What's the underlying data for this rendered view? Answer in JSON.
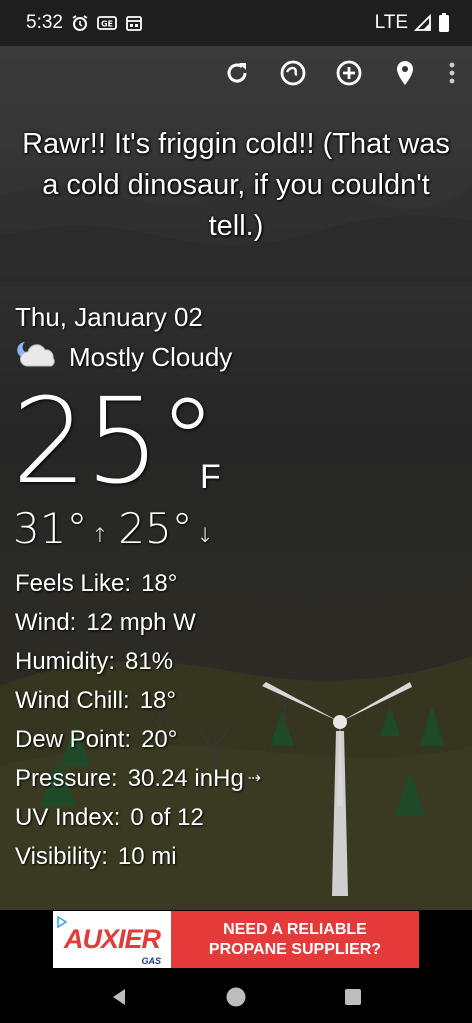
{
  "status_bar": {
    "time": "5:32",
    "icons": [
      "alarm-icon",
      "ge-icon",
      "calendar-icon"
    ],
    "network": "LTE",
    "right_icons": [
      "signal-icon",
      "battery-icon"
    ]
  },
  "toolbar": {
    "actions": [
      "refresh-icon",
      "radar-icon",
      "add-location-icon",
      "location-pin-icon",
      "more-vert-icon"
    ]
  },
  "headline": "Rawr!! It's friggin cold!! (That was a cold dinosaur, if you couldn't tell.)",
  "weather": {
    "date": "Thu, January 02",
    "condition": "Mostly Cloudy",
    "condition_icon": "mostly-cloudy-night-icon",
    "temperature": "25°",
    "unit": "F",
    "high": "31°",
    "high_arrow": "↑",
    "low": "25°",
    "low_arrow": "↓",
    "details": [
      {
        "label": "Feels Like:",
        "value": "18°"
      },
      {
        "label": "Wind:",
        "value": "12 mph W"
      },
      {
        "label": "Humidity:",
        "value": "81%"
      },
      {
        "label": "Wind Chill:",
        "value": "18°"
      },
      {
        "label": "Dew Point:",
        "value": "20°"
      },
      {
        "label": "Pressure:",
        "value": "30.24 inHg"
      },
      {
        "label": "UV Index:",
        "value": "0 of 12"
      },
      {
        "label": "Visibility:",
        "value": "10 mi"
      }
    ],
    "pressure_trend": "⇢"
  },
  "ad": {
    "brand": "AUXIER",
    "brand_sub": "GAS",
    "line1": "NEED A RELIABLE",
    "line2": "PROPANE SUPPLIER?",
    "colors": {
      "background": "#e43a3a",
      "logo_text": "#e43a3a"
    }
  },
  "nav": {
    "buttons": [
      "back-icon",
      "home-icon",
      "recents-icon"
    ]
  }
}
